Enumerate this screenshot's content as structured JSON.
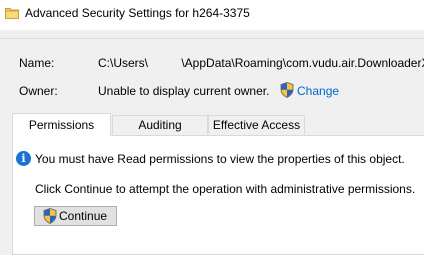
{
  "window": {
    "title": "Advanced Security Settings for h264-3375",
    "icon": "folder-icon"
  },
  "details": {
    "name_label": "Name:",
    "name_value": "C:\\Users\\          \\AppData\\Roaming\\com.vudu.air.DownloaderX",
    "owner_label": "Owner:",
    "owner_value": "Unable to display current owner.",
    "change_link": "Change"
  },
  "tabs": [
    {
      "label": "Permissions",
      "selected": true
    },
    {
      "label": "Auditing",
      "selected": false
    },
    {
      "label": "Effective Access",
      "selected": false
    }
  ],
  "panel": {
    "info_message": "You must have Read permissions to view the properties of this object.",
    "continue_message": "Click Continue to attempt the operation with administrative permissions.",
    "continue_button": "Continue"
  },
  "colors": {
    "link": "#0066cc",
    "info_icon": "#1a73d1",
    "shield_blue": "#2b62c5",
    "shield_yellow": "#f5c53a"
  }
}
